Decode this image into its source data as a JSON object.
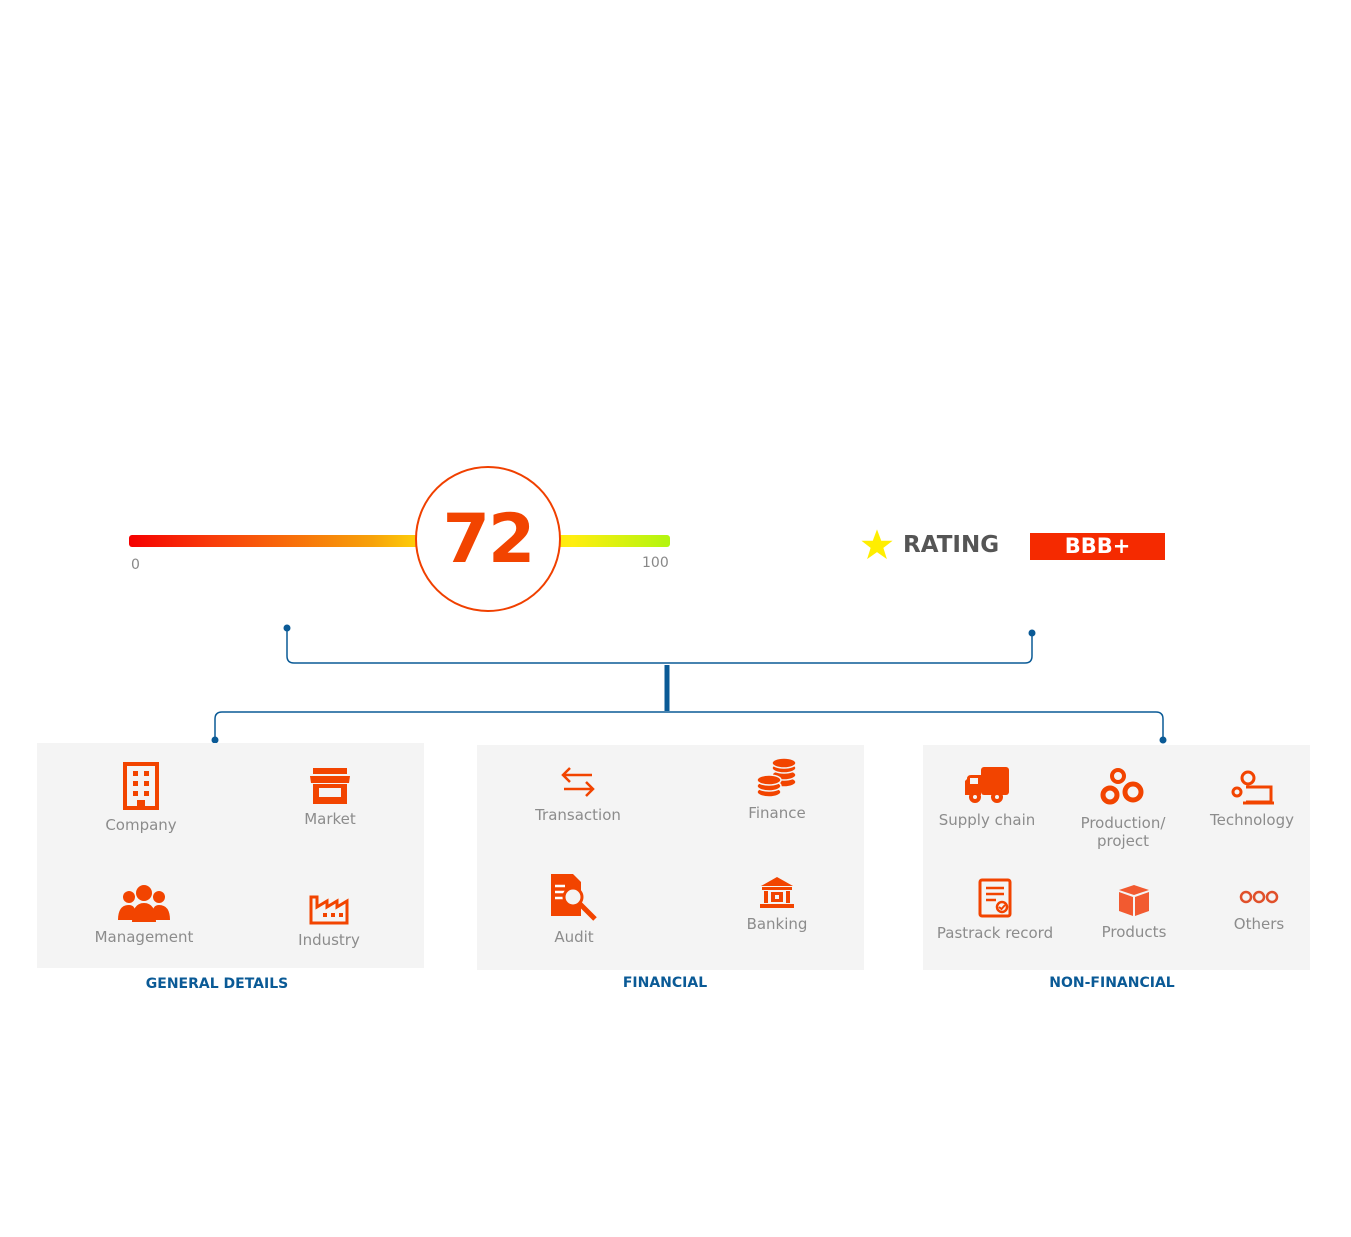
{
  "score": {
    "value": "72",
    "min_label": "0",
    "max_label": "100",
    "fraction": 0.72
  },
  "rating": {
    "label": "RATING",
    "grade": "BBB+",
    "star_color": "#ffee00",
    "badge_color": "#f52a00"
  },
  "colors": {
    "accent": "#f24400",
    "line": "#0a5a96",
    "panel": "#f4f4f4"
  },
  "sections": [
    {
      "title": "GENERAL DETAILS",
      "items": [
        {
          "label": "Company",
          "icon": "building-icon"
        },
        {
          "label": "Market",
          "icon": "storefront-icon"
        },
        {
          "label": "Management",
          "icon": "people-group-icon"
        },
        {
          "label": "Industry",
          "icon": "factory-icon"
        }
      ]
    },
    {
      "title": "FINANCIAL",
      "items": [
        {
          "label": "Transaction",
          "icon": "exchange-arrows-icon"
        },
        {
          "label": "Finance",
          "icon": "coins-stack-icon"
        },
        {
          "label": "Audit",
          "icon": "document-search-icon"
        },
        {
          "label": "Banking",
          "icon": "bank-icon"
        }
      ]
    },
    {
      "title": "NON-FINANCIAL",
      "items": [
        {
          "label": "Supply chain",
          "icon": "truck-icon"
        },
        {
          "label": "Production/ project",
          "icon": "gears-icon"
        },
        {
          "label": "Technology",
          "icon": "gear-laptop-icon"
        },
        {
          "label": "Pastrack record",
          "icon": "checked-document-icon"
        },
        {
          "label": "Products",
          "icon": "box-icon"
        },
        {
          "label": "Others",
          "icon": "three-circles-icon"
        }
      ]
    }
  ]
}
